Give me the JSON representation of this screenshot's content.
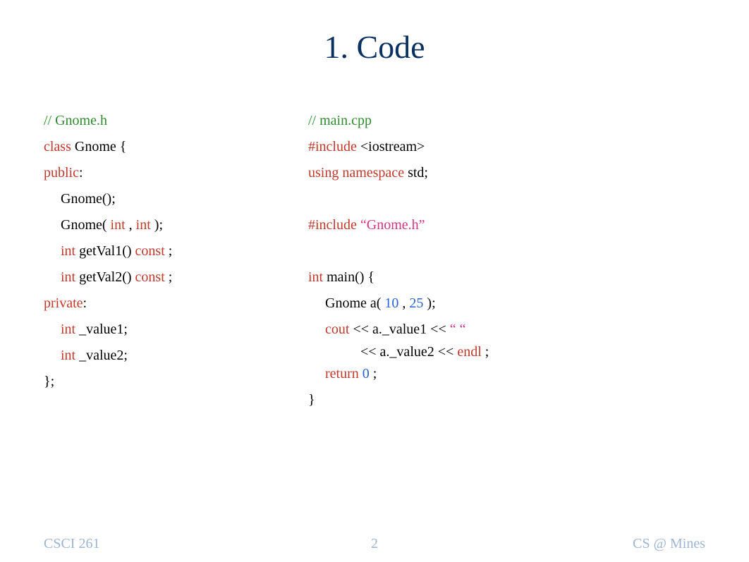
{
  "title": "1.    Code",
  "left": {
    "comment": "// Gnome.h",
    "class_kw": "class",
    "class_name": " Gnome {",
    "public_kw": "public",
    "public_colon": ":",
    "ctor0": "Gnome();",
    "ctor1_pre": "Gnome(  ",
    "int_kw": "int",
    "ctor1_comma": " ,  ",
    "ctor1_close": "  );",
    "getval1_name": " getVal1() ",
    "const_kw": "const",
    "semi": " ;",
    "getval2_name": " getVal2() ",
    "private_kw": "private",
    "private_colon": ":",
    "val1": " _value1;",
    "val2": " _value2;",
    "close": "};"
  },
  "right": {
    "comment": "// main.cpp",
    "include_kw": "#include",
    "iostream": " <iostream>",
    "using_ns": "using namespace",
    "std": " std;",
    "gnome_h": " “Gnome.h”",
    "int_kw": "int",
    "main_sig": " main() {",
    "gnome_a_pre": "Gnome a(   ",
    "ten": "10",
    "comma": " ,  ",
    "twentyfive": "25",
    "gnome_a_close": "  );",
    "cout_kw": "cout",
    "cout_line1": " << a._value1 << ",
    "space_str": "“ “",
    "cout_line2_indent": "          << a._value2 << ",
    "endl_kw": "endl",
    "semi": " ;",
    "return_kw": "return",
    "zero": " 0",
    "ret_semi": " ;",
    "close": "}"
  },
  "footer": {
    "left": "CSCI 261",
    "center": "2",
    "right": "CS @ Mines"
  }
}
